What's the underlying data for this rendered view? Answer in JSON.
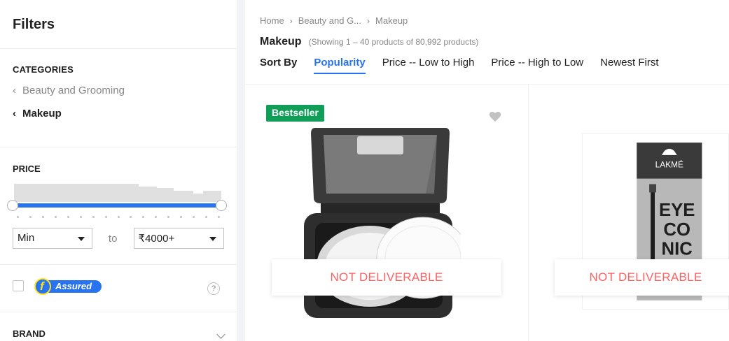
{
  "sidebar": {
    "title": "Filters",
    "categories": {
      "heading": "CATEGORIES",
      "parent": "Beauty and Grooming",
      "current": "Makeup"
    },
    "price": {
      "heading": "PRICE",
      "min_value": "Min",
      "to_label": "to",
      "max_value": "₹4000+"
    },
    "assured": {
      "label": "Assured",
      "help": "?"
    },
    "brand": {
      "heading": "BRAND"
    }
  },
  "breadcrumb": {
    "items": [
      "Home",
      "Beauty and G...",
      "Makeup"
    ],
    "separator": "›"
  },
  "header": {
    "title": "Makeup",
    "count": "(Showing 1 – 40 products of 80,992 products)"
  },
  "sort": {
    "label": "Sort By",
    "options": [
      "Popularity",
      "Price -- Low to High",
      "Price -- High to Low",
      "Newest First"
    ],
    "active": "Popularity"
  },
  "products": [
    {
      "badge": "Bestseller",
      "status": "NOT DELIVERABLE",
      "brand_text": ""
    },
    {
      "badge": "",
      "status": "NOT DELIVERABLE",
      "brand_text": "LAKMÉ",
      "product_text": "EYE CO NIC"
    }
  ],
  "colors": {
    "accent": "#2874f0",
    "badge": "#0f9d58",
    "not_deliverable": "#ff6161"
  }
}
